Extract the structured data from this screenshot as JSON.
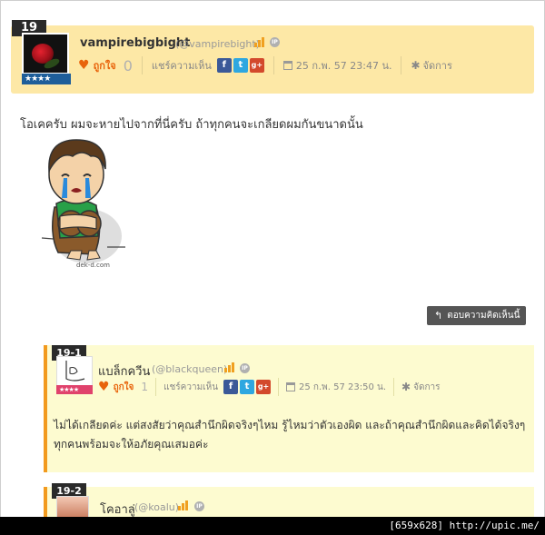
{
  "main_comment": {
    "number": "19",
    "username": "vampirebigbight",
    "handle": "(@vampirebight)",
    "like_label": "ถูกใจ",
    "like_count": "0",
    "share_label": "แชร์ความเห็น",
    "timestamp": "25 ก.พ. 57 23:47 น.",
    "manage_label": "จัดการ",
    "body": "โอเคครับ ผมจะหายไปจากที่นี่ครับ ถ้าทุกคนจะเกลียดผมกันขนาดนั้น",
    "image_caption": "dek-d.com",
    "reply_button": "ตอบความคิดเห็นนี้"
  },
  "replies": [
    {
      "number": "19-1",
      "username": "แบล็กควีน",
      "handle": "(@blackqueen)",
      "like_label": "ถูกใจ",
      "like_count": "1",
      "share_label": "แชร์ความเห็น",
      "timestamp": "25 ก.พ. 57 23:50 น.",
      "manage_label": "จัดการ",
      "body": "ไม่ได้เกลียดค่ะ แต่สงสัยว่าคุณสำนึกผิดจริงๆไหม รู้ไหมว่าตัวเองผิด และถ้าคุณสำนึกผิดและคิดได้จริงๆ ทุกคนพร้อมจะให้อภัยคุณเสมอค่ะ"
    },
    {
      "number": "19-2",
      "username": "โคอาลู่",
      "handle": "(@koalu)"
    }
  ],
  "icons": {
    "share_facebook": "f",
    "share_twitter": "t",
    "share_google": "g+",
    "ip_badge": "IP",
    "heart": "♥",
    "gear": "✱",
    "reply_arrow": "↰",
    "star": "★★★★"
  },
  "footer": {
    "text": "[659x628] http://upic.me/"
  },
  "colors": {
    "header_bg": "#fde8a6",
    "reply_bg": "#fdfbd0",
    "accent_orange": "#f29a1e",
    "like_orange": "#e8640c"
  }
}
